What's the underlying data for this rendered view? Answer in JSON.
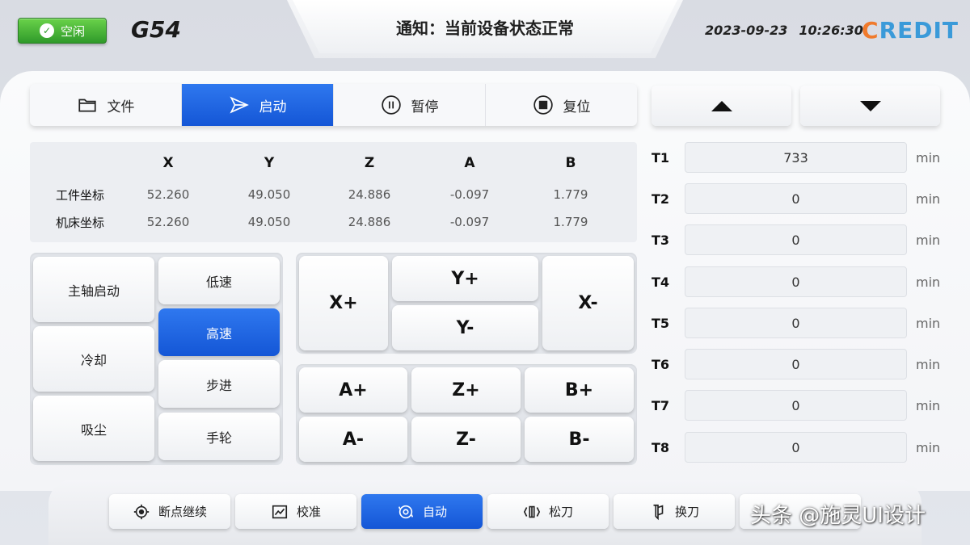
{
  "header": {
    "status": "空闲",
    "coord_system": "G54",
    "notice": "通知：当前设备状态正常",
    "date": "2023-09-23",
    "time": "10:26:30",
    "logo_c": "C",
    "logo_rest": "REDIT",
    "status_color": "#2f9a2a",
    "logo_colors": {
      "c": "#f07a2c",
      "rest": "#3a9ad9"
    }
  },
  "toolbar": {
    "items": [
      {
        "label": "文件",
        "icon": "folder-icon"
      },
      {
        "label": "启动",
        "icon": "send-icon",
        "active": true
      },
      {
        "label": "暂停",
        "icon": "pause-icon"
      },
      {
        "label": "复位",
        "icon": "stop-icon"
      }
    ]
  },
  "coords": {
    "axes": [
      "X",
      "Y",
      "Z",
      "A",
      "B"
    ],
    "rows": [
      {
        "label": "工件坐标",
        "values": [
          "52.260",
          "49.050",
          "24.886",
          "-0.097",
          "1.779"
        ]
      },
      {
        "label": "机床坐标",
        "values": [
          "52.260",
          "49.050",
          "24.886",
          "-0.097",
          "1.779"
        ]
      }
    ]
  },
  "spindle": {
    "left": [
      "主轴启动",
      "冷却",
      "吸尘"
    ],
    "right": [
      "低速",
      "高速",
      "步进",
      "手轮"
    ],
    "active_right": "高速"
  },
  "jog": {
    "xplus": "X+",
    "xminus": "X-",
    "yplus": "Y+",
    "yminus": "Y-",
    "aplus": "A+",
    "zplus": "Z+",
    "bplus": "B+",
    "aminus": "A-",
    "zminus": "Z-",
    "bminus": "B-"
  },
  "tools": [
    {
      "name": "T1",
      "value": "733",
      "unit": "min"
    },
    {
      "name": "T2",
      "value": "0",
      "unit": "min"
    },
    {
      "name": "T3",
      "value": "0",
      "unit": "min"
    },
    {
      "name": "T4",
      "value": "0",
      "unit": "min"
    },
    {
      "name": "T5",
      "value": "0",
      "unit": "min"
    },
    {
      "name": "T6",
      "value": "0",
      "unit": "min"
    },
    {
      "name": "T7",
      "value": "0",
      "unit": "min"
    },
    {
      "name": "T8",
      "value": "0",
      "unit": "min"
    }
  ],
  "bottom": [
    {
      "label": "断点继续",
      "icon": "target-icon"
    },
    {
      "label": "校准",
      "icon": "chart-icon"
    },
    {
      "label": "自动",
      "icon": "auto-icon",
      "active": true
    },
    {
      "label": "松刀",
      "icon": "release-tool-icon"
    },
    {
      "label": "换刀",
      "icon": "change-tool-icon"
    },
    {
      "label": "",
      "icon": ""
    }
  ],
  "watermark": "头条 @施灵UI设计",
  "accent_blue": "#1456d6"
}
